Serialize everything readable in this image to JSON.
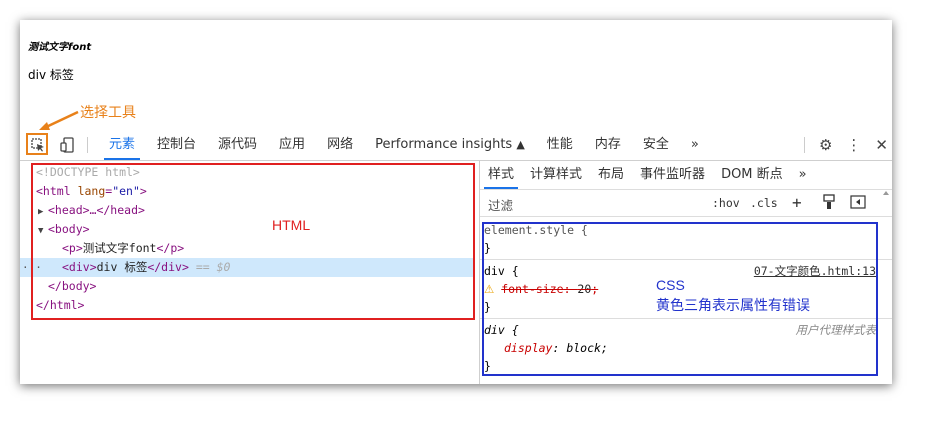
{
  "page": {
    "paragraph_text": "测试文字font",
    "div_text": "div 标签"
  },
  "annotations": {
    "select_tool": "选择工具",
    "html": "HTML",
    "css_title": "CSS",
    "css_note": "黄色三角表示属性有错误"
  },
  "toolbar": {
    "tabs": [
      "元素",
      "控制台",
      "源代码",
      "应用",
      "网络",
      "Performance insights",
      "性能",
      "内存",
      "安全",
      "»"
    ],
    "active_tab": "元素"
  },
  "dom_tree": {
    "doctype": "<!DOCTYPE html>",
    "html_open_tag": "<html",
    "html_attr_name": "lang",
    "html_attr_value": "\"en\"",
    "html_open_end": ">",
    "head_collapsed": "<head>…</head>",
    "body_open": "<body>",
    "p_open": "<p>",
    "p_text": "测试文字font",
    "p_close": "</p>",
    "div_open": "<div>",
    "div_text": "div 标签",
    "div_close": "</div>",
    "selected_marker": "== $0",
    "body_close": "</body>",
    "html_close": "</html>",
    "dots": "···"
  },
  "styles": {
    "tabs": [
      "样式",
      "计算样式",
      "布局",
      "事件监听器",
      "DOM 断点",
      "»"
    ],
    "active_tab": "样式",
    "filter_placeholder": "过滤",
    "hov": ":hov",
    "cls": ".cls",
    "element_style": "element.style {",
    "close_brace": "}",
    "div_selector": "div {",
    "div_source": "07-文字颜色.html:13",
    "invalid_prop": "font-size",
    "invalid_value": "20",
    "ua_selector": "div {",
    "ua_label": "用户代理样式表",
    "ua_prop": "display",
    "ua_value": "block"
  },
  "colors": {
    "accent_orange": "#e8811a",
    "html_box_red": "#e02020",
    "css_box_blue": "#2233cc",
    "active_tab_blue": "#1a73e8",
    "selected_row": "#cfe8fc"
  },
  "icons": [
    "inspect-icon",
    "device-toggle-icon",
    "gear-icon",
    "kebab-menu-icon",
    "close-icon",
    "plus-icon",
    "paint-brush-icon",
    "sidebar-toggle-icon",
    "warning-icon"
  ]
}
